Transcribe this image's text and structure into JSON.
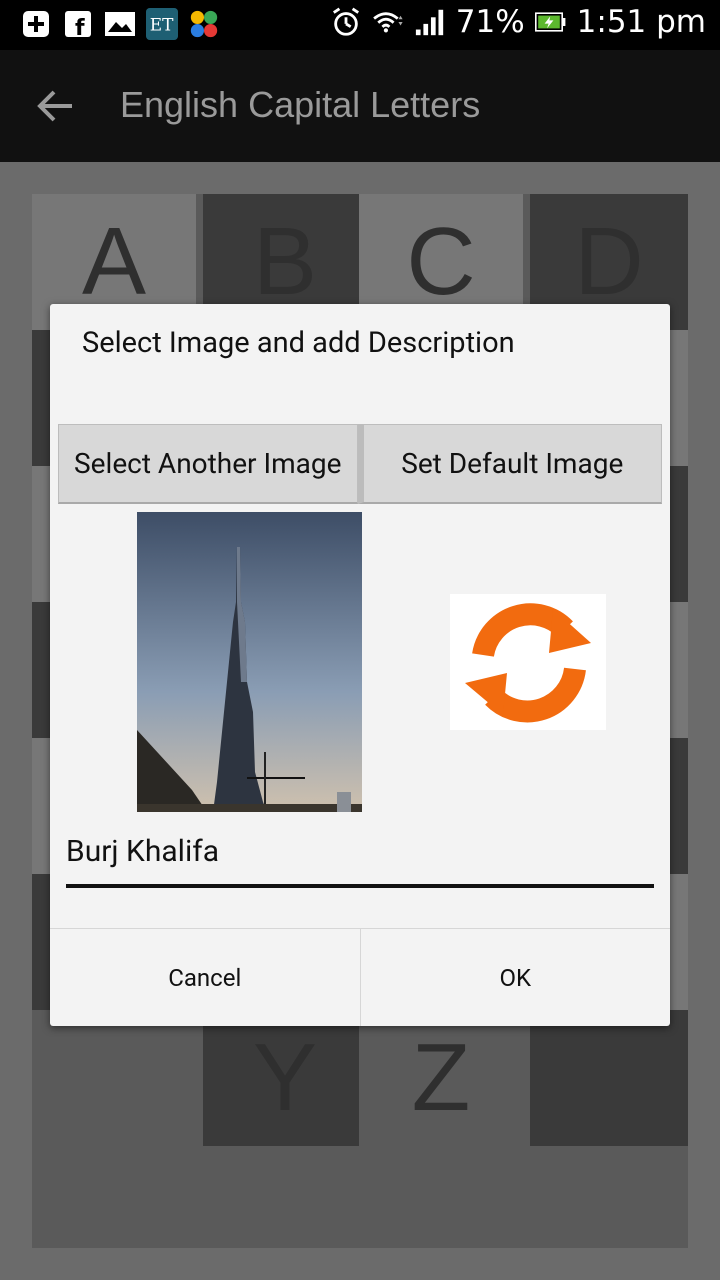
{
  "status_bar": {
    "battery": "71%",
    "time": "1:51 pm",
    "icons": [
      "add-box-icon",
      "facebook-icon",
      "image-icon",
      "et-icon",
      "app-icon",
      "alarm-icon",
      "wifi-icon",
      "signal-icon",
      "battery-icon"
    ]
  },
  "action_bar": {
    "title": "English Capital Letters"
  },
  "grid": {
    "letters_top": [
      "A",
      "B",
      "C",
      "D"
    ],
    "letters_bottom": [
      "Y",
      "Z"
    ]
  },
  "dialog": {
    "title": "Select Image and add Description",
    "select_another_label": "Select Another Image",
    "set_default_label": "Set Default Image",
    "description_value": "Burj Khalifa",
    "cancel_label": "Cancel",
    "ok_label": "OK",
    "refresh_color": "#f26b0f"
  }
}
